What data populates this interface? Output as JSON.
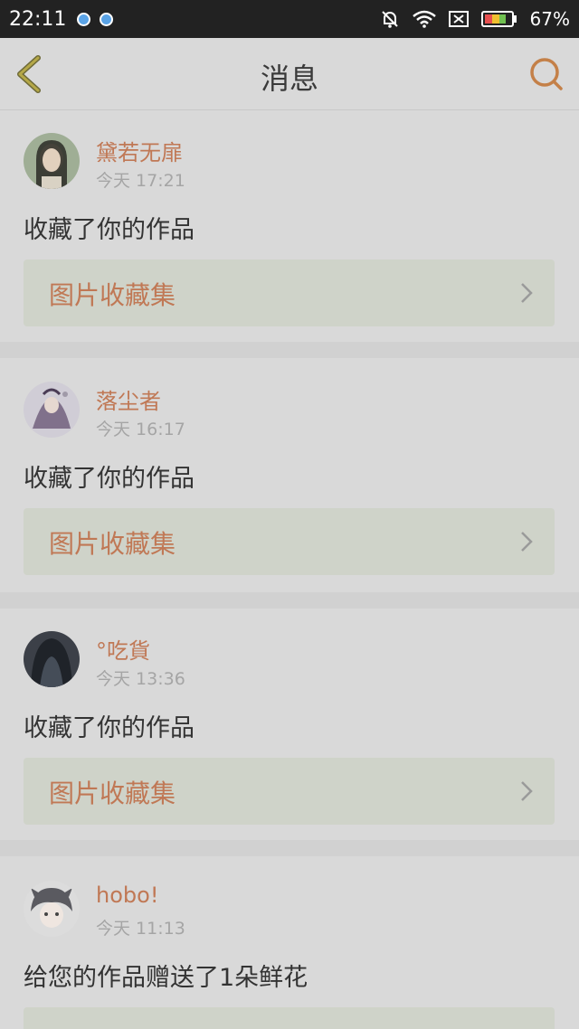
{
  "status_bar": {
    "time": "22:11",
    "notification_icons": [
      "app-icon",
      "app-icon"
    ],
    "battery_percent": "67%"
  },
  "nav": {
    "title": "消息",
    "back_icon": "chevron-left-icon",
    "search_icon": "search-icon",
    "accent": "#b07a2a"
  },
  "messages": [
    {
      "name": "黛若无扉",
      "time": "今天 17:21",
      "action": "收藏了你的作品",
      "link": "图片收藏集"
    },
    {
      "name": "落尘者",
      "time": "今天 16:17",
      "action": "收藏了你的作品",
      "link": "图片收藏集"
    },
    {
      "name": "°吃貨",
      "time": "今天 13:36",
      "action": "收藏了你的作品",
      "link": "图片收藏集"
    },
    {
      "name": "hobo!",
      "time": "今天 11:13",
      "action": "给您的作品赠送了1朵鲜花",
      "link": ""
    }
  ],
  "colors": {
    "name_color": "#c07855",
    "link_box": "#cfd3c9",
    "overlay_background": "#d9d9d9"
  }
}
